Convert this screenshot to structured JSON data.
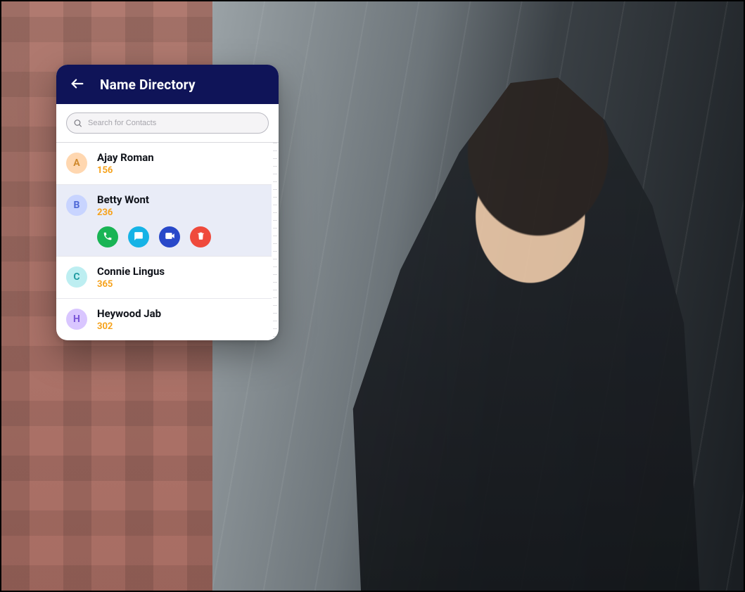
{
  "header": {
    "title": "Name Directory"
  },
  "search": {
    "placeholder": "Search for Contacts"
  },
  "avatarColors": {
    "A": {
      "bg": "#ffd7b0",
      "fg": "#d08a2f"
    },
    "B": {
      "bg": "#c8d4ff",
      "fg": "#4e68d6"
    },
    "C": {
      "bg": "#bdeef1",
      "fg": "#1f9aa0"
    },
    "H": {
      "bg": "#d9c6ff",
      "fg": "#7a55d8"
    }
  },
  "actionLabels": {
    "call": "Call",
    "chat": "Chat",
    "video": "Video call",
    "delete": "Delete"
  },
  "contacts": [
    {
      "letter": "A",
      "name": "Ajay Roman",
      "ext": "156",
      "selected": false
    },
    {
      "letter": "B",
      "name": "Betty Wont",
      "ext": "236",
      "selected": true
    },
    {
      "letter": "C",
      "name": "Connie Lingus",
      "ext": "365",
      "selected": false
    },
    {
      "letter": "H",
      "name": "Heywood Jab",
      "ext": "302",
      "selected": false
    }
  ]
}
